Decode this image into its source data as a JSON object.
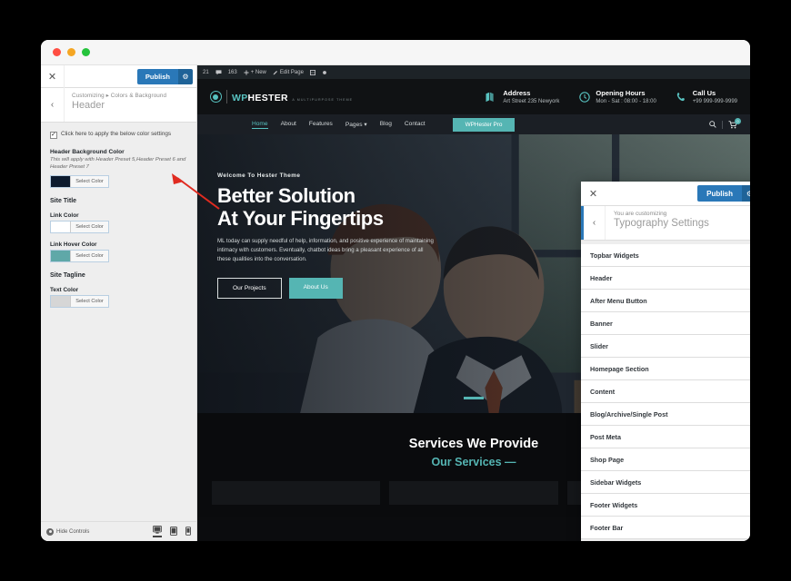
{
  "window": {
    "traffic_lights": [
      "red",
      "yellow",
      "green"
    ]
  },
  "customizer": {
    "close_label": "✕",
    "publish_label": "Publish",
    "gear_icon": "⚙",
    "back_icon": "‹",
    "breadcrumb": "Customizing ▸ Colors & Background",
    "title": "Header",
    "checkbox_label": "Click here to apply the below color settings",
    "header_bg": {
      "title": "Header Background Color",
      "description": "This will apply with Header Preset 5,Header Preset 6 and Header Preset 7",
      "swatch": "#0d1b2e",
      "button_label": "Select Color"
    },
    "site_title_section": "Site Title",
    "link_color": {
      "label": "Link Color",
      "swatch": "#ffffff",
      "button_label": "Select Color"
    },
    "link_hover_color": {
      "label": "Link Hover Color",
      "swatch": "#5fa8a8",
      "button_label": "Select Color"
    },
    "site_tagline_section": "Site Tagline",
    "text_color": {
      "label": "Text Color",
      "swatch": "#d6d6d6",
      "button_label": "Select Color"
    },
    "footer": {
      "hide_controls": "Hide Controls",
      "devices": [
        "desktop",
        "tablet",
        "mobile"
      ],
      "active_device": "desktop"
    }
  },
  "annotation": {
    "arrow_color": "#e02b20"
  },
  "preview": {
    "adminbar": {
      "items": [
        "21",
        "comments",
        "163",
        "+ New",
        "Edit Page",
        "grid",
        "dot"
      ]
    },
    "site_header": {
      "logo_name_part1": "WP",
      "logo_name_part2": "HESTER",
      "logo_tagline": "A MULTIPURPOSE THEME",
      "info": [
        {
          "icon": "map-icon",
          "title": "Address",
          "sub": "Art Street 235 Newyork"
        },
        {
          "icon": "clock-icon",
          "title": "Opening Hours",
          "sub": "Mon - Sat : 08:00 - 18:00"
        },
        {
          "icon": "phone-icon",
          "title": "Call Us",
          "sub": "+99 999-999-9999"
        }
      ]
    },
    "nav": {
      "links": [
        {
          "label": "Home",
          "active": true
        },
        {
          "label": "About",
          "active": false
        },
        {
          "label": "Features",
          "active": false
        },
        {
          "label": "Pages ▾",
          "active": false
        },
        {
          "label": "Blog",
          "active": false
        },
        {
          "label": "Contact",
          "active": false
        }
      ],
      "cta_label": "WPHester Pro",
      "cart_count": "0"
    },
    "hero": {
      "eyebrow": "Welcome To Hester Theme",
      "title_line1": "Better Solution",
      "title_line2": "At Your Fingertips",
      "description": "ML today can supply needful of help, information, and positive experience of maintaining intimacy with customers. Eventually, chatbot ideas bring a pleasant experience of all these qualities into the conversation.",
      "button_primary": "Our Projects",
      "button_secondary": "About Us"
    },
    "services": {
      "heading": "Services We Provide",
      "subheading": "Our Services —"
    }
  },
  "typography_panel": {
    "close_label": "✕",
    "publish_label": "Publish",
    "gear_icon": "⚙",
    "back_icon": "‹",
    "eyebrow": "You are customizing",
    "title": "Typography Settings",
    "items": [
      {
        "label": "Topbar Widgets"
      },
      {
        "label": "Header"
      },
      {
        "label": "After Menu Button"
      },
      {
        "label": "Banner"
      },
      {
        "label": "Slider"
      },
      {
        "label": "Homepage Section"
      },
      {
        "label": "Content"
      },
      {
        "label": "Blog/Archive/Single Post"
      },
      {
        "label": "Post Meta"
      },
      {
        "label": "Shop Page"
      },
      {
        "label": "Sidebar Widgets"
      },
      {
        "label": "Footer Widgets"
      },
      {
        "label": "Footer Bar"
      }
    ],
    "chevron": "›"
  }
}
